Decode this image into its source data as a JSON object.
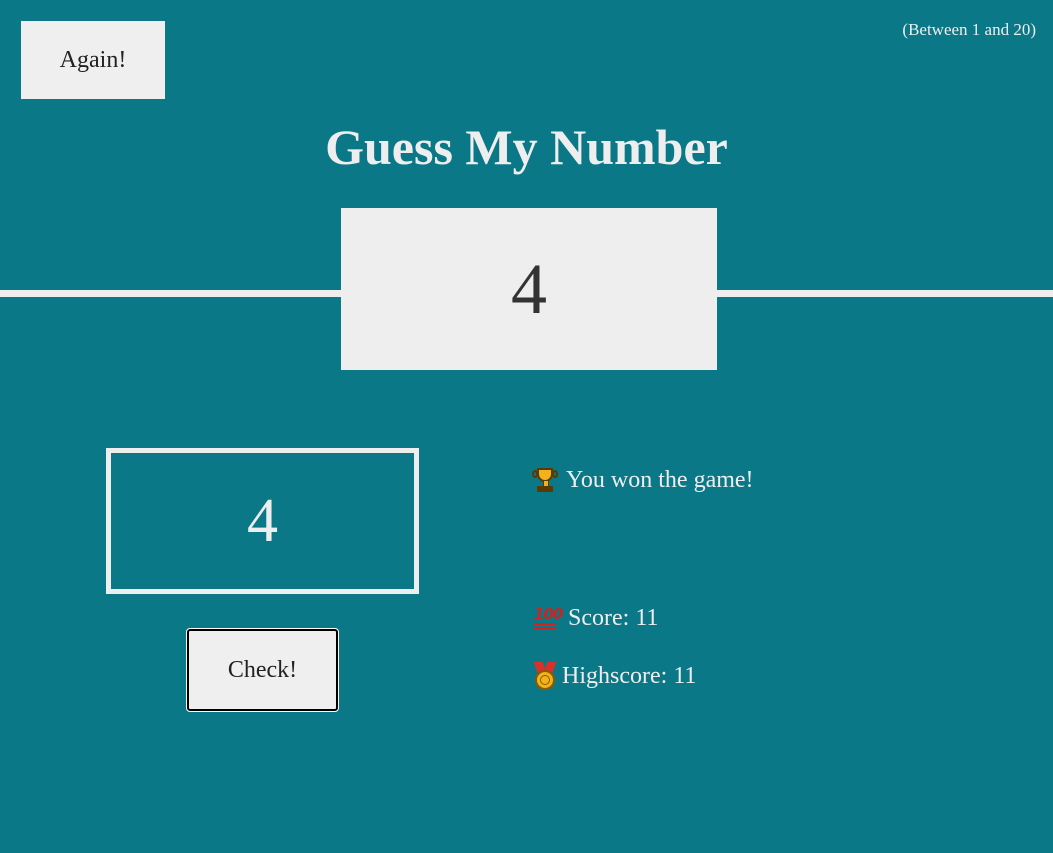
{
  "header": {
    "again_label": "Again!",
    "range_hint": "(Between 1 and 20)",
    "title": "Guess My Number"
  },
  "secret_number": "4",
  "guess": {
    "value": "4"
  },
  "check_label": "Check!",
  "status": {
    "message": "You won the game!",
    "message_icon": "trophy-icon",
    "score_label": "Score: ",
    "score_value": "11",
    "score_icon": "hundred-points-icon",
    "highscore_label": "Highscore: ",
    "highscore_value": "11",
    "highscore_icon": "medal-icon"
  },
  "colors": {
    "background": "#0a7887",
    "panel": "#eeeeee",
    "text_dark": "#333333"
  }
}
